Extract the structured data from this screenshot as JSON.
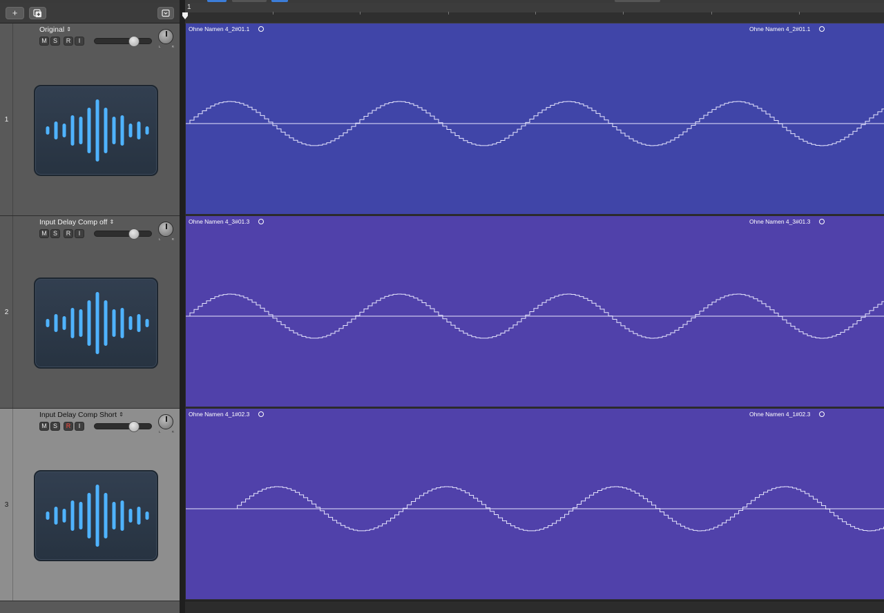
{
  "header_toolbar": {
    "add_track_label": "+"
  },
  "ruler": {
    "bar_label": "1"
  },
  "tracks": [
    {
      "number": "1",
      "name": "Original",
      "buttons": [
        "M",
        "S",
        "R",
        "I"
      ],
      "record_armed": false,
      "selected": false,
      "volume_level": 0.72,
      "region": {
        "name": "Ohne Namen 4_2#01.1",
        "color": "#4045a8",
        "wave_offset_bars": 0
      }
    },
    {
      "number": "2",
      "name": "Input Delay Comp off",
      "buttons": [
        "M",
        "S",
        "R",
        "I"
      ],
      "record_armed": false,
      "selected": false,
      "volume_level": 0.72,
      "region": {
        "name": "Ohne Namen 4_3#01.3",
        "color": "#5041aa",
        "wave_offset_bars": 0
      }
    },
    {
      "number": "3",
      "name": "Input Delay Comp Short",
      "buttons": [
        "M",
        "S",
        "R",
        "I"
      ],
      "record_armed": true,
      "selected": true,
      "volume_level": 0.72,
      "region": {
        "name": "Ohne Namen 4_1#02.3",
        "color": "#5041aa",
        "wave_offset_bars": 0.28
      }
    }
  ],
  "colors": {
    "icon_wave": "#4fb3ff",
    "waveform_line": "#e8e8ff",
    "record_red": "#ff4a3c"
  },
  "icons": {
    "track_icon": "audio-waveform-icon",
    "loop": "loop-circle-icon",
    "pan": "pan-knob-icon"
  }
}
